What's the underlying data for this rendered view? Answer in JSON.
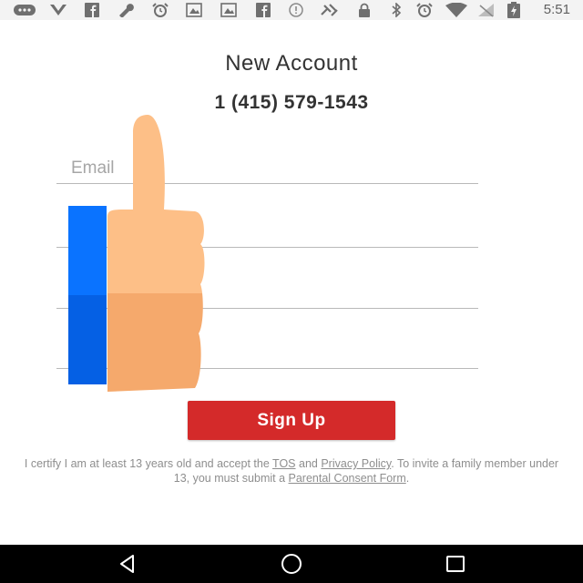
{
  "status_bar": {
    "time": "5:51",
    "icons": [
      "message-icon",
      "signal-v-icon",
      "facebook-icon",
      "wrench-icon",
      "alarm-icon",
      "image-icon",
      "image-icon",
      "facebook-icon",
      "info-icon",
      "satellite-icon",
      "lock-icon",
      "bluetooth-icon",
      "alarm-icon",
      "wifi-icon",
      "no-signal-icon",
      "battery-charging-icon"
    ]
  },
  "form": {
    "title": "New Account",
    "phone": "1 (415) 579-1543",
    "email_placeholder": "Email",
    "signup_label": "Sign Up"
  },
  "legal": {
    "text_1": "I certify I am at least 13 years old and accept the",
    "tos_link": "TOS",
    "text_2": "and",
    "privacy_link": "Privacy Policy",
    "text_3": ". To invite a family member under 13, you must submit a",
    "consent_link": "Parental Consent Form",
    "text_4": "."
  },
  "colors": {
    "accent_red": "#d42a2a",
    "overlay_blue": "#0a73ff",
    "thumb_skin": "#fdbf87"
  }
}
